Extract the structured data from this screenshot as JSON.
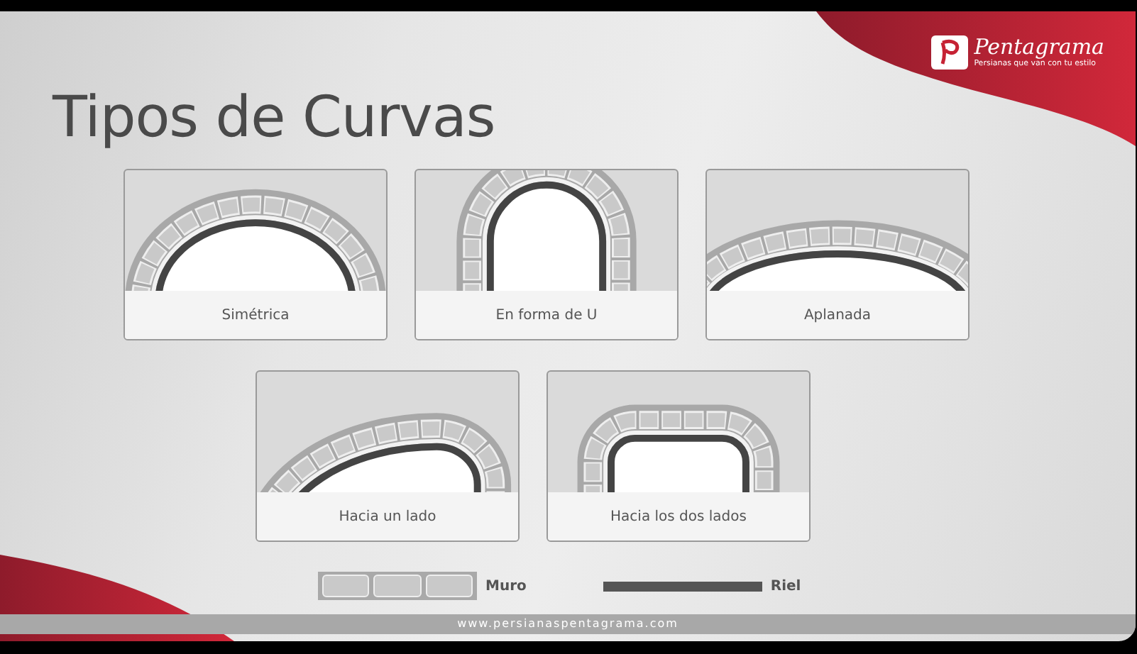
{
  "logo": {
    "name": "Pentagrama",
    "tagline": "Persianas que van con tu estilo"
  },
  "title": "Tipos de Curvas",
  "cards": [
    {
      "label": "Simétrica",
      "kind": "symmetric"
    },
    {
      "label": "En forma de U",
      "kind": "u"
    },
    {
      "label": "Aplanada",
      "kind": "flat"
    },
    {
      "label": "Hacia un lado",
      "kind": "one-side"
    },
    {
      "label": "Hacia los dos lados",
      "kind": "two-sides"
    }
  ],
  "legend": [
    {
      "kind": "wall",
      "label": "Muro"
    },
    {
      "kind": "rail",
      "label": "Riel"
    }
  ],
  "footer": "www.persianaspentagrama.com"
}
